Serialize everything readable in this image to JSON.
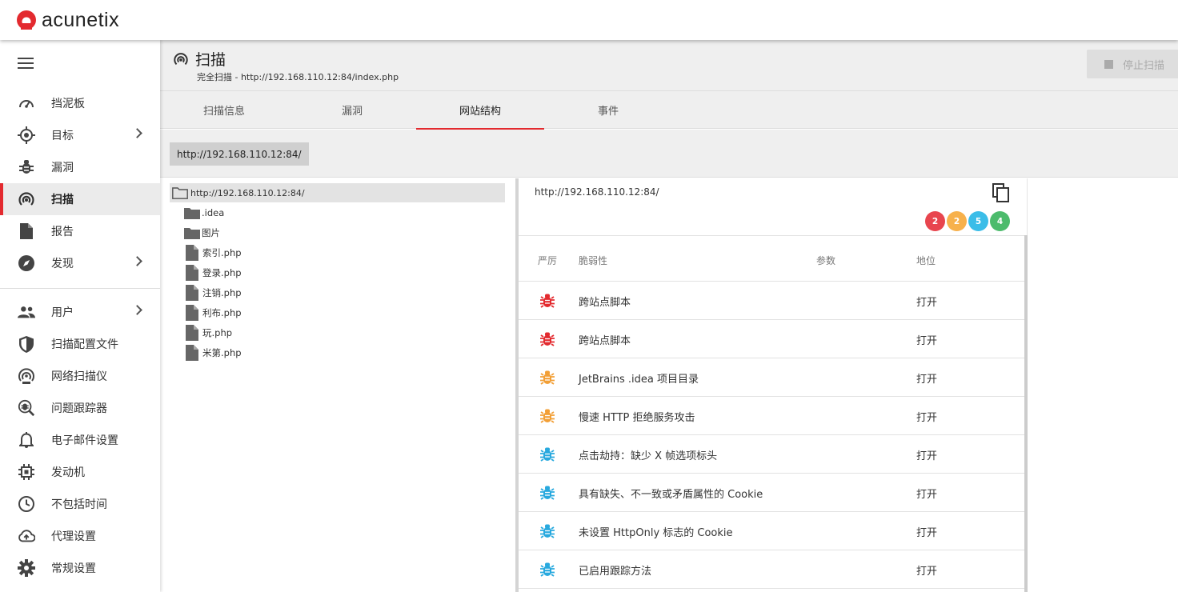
{
  "app": {
    "name": "acunetix",
    "brand_color": "#e32a2f"
  },
  "sidebar": {
    "items": [
      {
        "label": "挡泥板",
        "icon": "dashboard-gauge-icon",
        "chevron": false
      },
      {
        "label": "目标",
        "icon": "target-crosshair-icon",
        "chevron": true
      },
      {
        "label": "漏洞",
        "icon": "bug-icon",
        "chevron": false
      },
      {
        "label": "扫描",
        "icon": "scan-radar-icon",
        "chevron": false,
        "active": true
      },
      {
        "label": "报告",
        "icon": "report-file-icon",
        "chevron": false
      },
      {
        "label": "发现",
        "icon": "compass-icon",
        "chevron": true
      }
    ],
    "items2": [
      {
        "label": "用户",
        "icon": "users-icon",
        "chevron": true
      },
      {
        "label": "扫描配置文件",
        "icon": "shield-icon"
      },
      {
        "label": "网络扫描仪",
        "icon": "network-scanner-icon"
      },
      {
        "label": "问题跟踪器",
        "icon": "issue-tracker-icon"
      },
      {
        "label": "电子邮件设置",
        "icon": "bell-icon"
      },
      {
        "label": "发动机",
        "icon": "engine-chip-icon"
      },
      {
        "label": "不包括时间",
        "icon": "clock-icon"
      },
      {
        "label": "代理设置",
        "icon": "cloud-upload-icon"
      },
      {
        "label": "常规设置",
        "icon": "gear-icon"
      }
    ]
  },
  "header": {
    "title": "扫描",
    "subtitle": "完全扫描 - http://192.168.110.12:84/index.php",
    "stop_label": "停止扫描"
  },
  "tabs": [
    {
      "label": "扫描信息"
    },
    {
      "label": "漏洞"
    },
    {
      "label": "网站结构",
      "active": true
    },
    {
      "label": "事件"
    }
  ],
  "breadcrumb": "http://192.168.110.12:84/",
  "tree": {
    "root": "http://192.168.110.12:84/",
    "items": [
      {
        "label": ".idea",
        "type": "folder"
      },
      {
        "label": "图片",
        "type": "folder"
      },
      {
        "label": "索引.php",
        "type": "file"
      },
      {
        "label": "登录.php",
        "type": "file"
      },
      {
        "label": "注销.php",
        "type": "file"
      },
      {
        "label": "利布.php",
        "type": "file"
      },
      {
        "label": "玩.php",
        "type": "file"
      },
      {
        "label": "米第.php",
        "type": "file"
      }
    ]
  },
  "detail": {
    "url": "http://192.168.110.12:84/",
    "counts": [
      {
        "value": "2",
        "color": "#e8454e"
      },
      {
        "value": "2",
        "color": "#f7b14c"
      },
      {
        "value": "5",
        "color": "#3bbde8"
      },
      {
        "value": "4",
        "color": "#4cbb6c"
      }
    ],
    "columns": {
      "severity": "严厉",
      "vulnerability": "脆弱性",
      "parameter": "参数",
      "status": "地位"
    },
    "rows": [
      {
        "severity": "high",
        "color": "#e32a2f",
        "name": "跨站点脚本",
        "status": "打开"
      },
      {
        "severity": "high",
        "color": "#e32a2f",
        "name": "跨站点脚本",
        "status": "打开"
      },
      {
        "severity": "medium",
        "color": "#f29f36",
        "name": "JetBrains .idea 项目目录",
        "status": "打开"
      },
      {
        "severity": "medium",
        "color": "#f29f36",
        "name": "慢速 HTTP 拒绝服务攻击",
        "status": "打开"
      },
      {
        "severity": "low",
        "color": "#28a9de",
        "name": "点击劫持：缺少 X 帧选项标头",
        "status": "打开"
      },
      {
        "severity": "low",
        "color": "#28a9de",
        "name": "具有缺失、不一致或矛盾属性的 Cookie",
        "status": "打开"
      },
      {
        "severity": "low",
        "color": "#28a9de",
        "name": "未设置 HttpOnly 标志的 Cookie",
        "status": "打开"
      },
      {
        "severity": "low",
        "color": "#28a9de",
        "name": "已启用跟踪方法",
        "status": "打开"
      }
    ]
  }
}
